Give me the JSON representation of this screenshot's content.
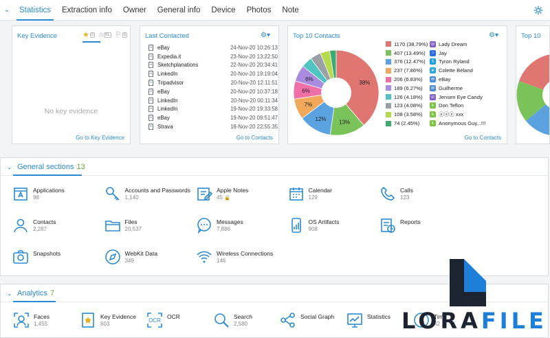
{
  "tabs": [
    "Statistics",
    "Extraction info",
    "Owner",
    "General info",
    "Device",
    "Photos",
    "Note"
  ],
  "key_evidence": {
    "title": "Key Evidence",
    "icon_badges": [
      "0",
      "BL",
      "0"
    ],
    "empty_text": "No key evidence",
    "footer": "Go to Key Evidence"
  },
  "last_contacted": {
    "title": "Last Contacted",
    "footer": "Go to Contacts",
    "rows": [
      {
        "name": "eBay",
        "date": "24-Nov-20 10:26:13"
      },
      {
        "name": "Expedia.it",
        "date": "23-Nov-20 13:22:50"
      },
      {
        "name": "Sketchplanations",
        "date": "22-Nov-20 20:34:41"
      },
      {
        "name": "LinkedIn",
        "date": "20-Nov-20 19:19:04"
      },
      {
        "name": "Tripadvisor",
        "date": "20-Nov-20 12:11:51"
      },
      {
        "name": "eBay",
        "date": "20-Nov-20 10:37:18"
      },
      {
        "name": "LinkedIn",
        "date": "20-Nov-20 00:11:34"
      },
      {
        "name": "LinkedIn",
        "date": "19-Nov-20 19:33:58"
      },
      {
        "name": "eBay",
        "date": "19-Nov-20 09:51:47"
      },
      {
        "name": "Strava",
        "date": "18-Nov-20 22:55:35"
      }
    ]
  },
  "top_contacts": {
    "title": "Top 10 Contacts",
    "footer": "Go to Contacts",
    "rows": [
      {
        "count": "1170",
        "pct": "(38.79%)",
        "name": "Lady Dream",
        "app": "viber",
        "color": "#e07671"
      },
      {
        "count": "407",
        "pct": "(13.49%)",
        "name": "Jay",
        "app": "signal",
        "color": "#7ac35a"
      },
      {
        "count": "376",
        "pct": "(12.47%)",
        "name": "Tyron Ryland",
        "app": "skype",
        "color": "#5ba3e0"
      },
      {
        "count": "237",
        "pct": "(7.86%)",
        "name": "Colette Béland",
        "app": "telegram",
        "color": "#f2a85a"
      },
      {
        "count": "206",
        "pct": "(6.83%)",
        "name": "eBay",
        "app": "mail",
        "color": "#ef6fa6"
      },
      {
        "count": "189",
        "pct": "(6.27%)",
        "name": "Guilherme",
        "app": "mail",
        "color": "#a98bdf"
      },
      {
        "count": "126",
        "pct": "(4.18%)",
        "name": "Jensen Eye Candy",
        "app": "viber",
        "color": "#4fc4c0"
      },
      {
        "count": "123",
        "pct": "(4.08%)",
        "name": "Don Teflon",
        "app": "kik",
        "color": "#9aa0a6"
      },
      {
        "count": "108",
        "pct": "(3.58%)",
        "name": "ⓧⓧⓧ xxx",
        "app": "kik",
        "color": "#b5d94f"
      },
      {
        "count": "74",
        "pct": "(2.45%)",
        "name": "Anonymous Guy...!!!",
        "app": "kik",
        "color": "#3daa72"
      }
    ]
  },
  "chart_data": {
    "type": "pie",
    "title": "Top 10 Contacts",
    "categories": [
      "Lady Dream",
      "Jay",
      "Tyron Ryland",
      "Colette Béland",
      "eBay",
      "Guilherme",
      "Jensen Eye Candy",
      "Don Teflon",
      "ⓧⓧⓧ xxx",
      "Anonymous Guy...!!!"
    ],
    "values": [
      1170,
      407,
      376,
      237,
      206,
      189,
      126,
      123,
      108,
      74
    ],
    "slice_labels": [
      "38%",
      "13%",
      "12%",
      "7%",
      "6%",
      "6%"
    ]
  },
  "peek_panel": {
    "title": "Top 10"
  },
  "general_sections": {
    "title": "General sections",
    "count": "13",
    "items": [
      {
        "label": "Applications",
        "count": "98",
        "icon": "applications-icon"
      },
      {
        "label": "Accounts and Passwords",
        "count": "1,140",
        "icon": "key-icon"
      },
      {
        "label": "Apple Notes",
        "count": "45",
        "icon": "notes-icon",
        "locked": true
      },
      {
        "label": "Calendar",
        "count": "129",
        "icon": "calendar-icon"
      },
      {
        "label": "Calls",
        "count": "123",
        "icon": "phone-icon"
      },
      {
        "label": "Contacts",
        "count": "2,287",
        "icon": "contact-icon"
      },
      {
        "label": "Files",
        "count": "20,537",
        "icon": "folder-icon"
      },
      {
        "label": "Messages",
        "count": "7,886",
        "icon": "chat-icon"
      },
      {
        "label": "OS Artifacts",
        "count": "908",
        "icon": "os-artifacts-icon"
      },
      {
        "label": "Reports",
        "count": "",
        "icon": "reports-icon"
      },
      {
        "label": "Snapshots",
        "count": "",
        "icon": "camera-icon"
      },
      {
        "label": "WebKit Data",
        "count": "349",
        "icon": "compass-icon"
      },
      {
        "label": "Wireless Connections",
        "count": "146",
        "icon": "wifi-icon"
      }
    ]
  },
  "analytics": {
    "title": "Analytics",
    "count": "7",
    "items": [
      {
        "label": "Faces",
        "count": "1,455",
        "icon": "face-icon"
      },
      {
        "label": "Key Evidence",
        "count": "603",
        "icon": "key-evidence-icon"
      },
      {
        "label": "OCR",
        "count": "",
        "icon": "ocr-icon"
      },
      {
        "label": "Search",
        "count": "2,580",
        "icon": "search-icon"
      },
      {
        "label": "Social Graph",
        "count": "",
        "icon": "social-graph-icon"
      },
      {
        "label": "Statistics",
        "count": "",
        "icon": "statistics-icon"
      },
      {
        "label": "Tim",
        "count": "42",
        "icon": "timeline-icon"
      }
    ]
  },
  "watermark": {
    "part1": "LORA",
    "part2": "FILE"
  }
}
